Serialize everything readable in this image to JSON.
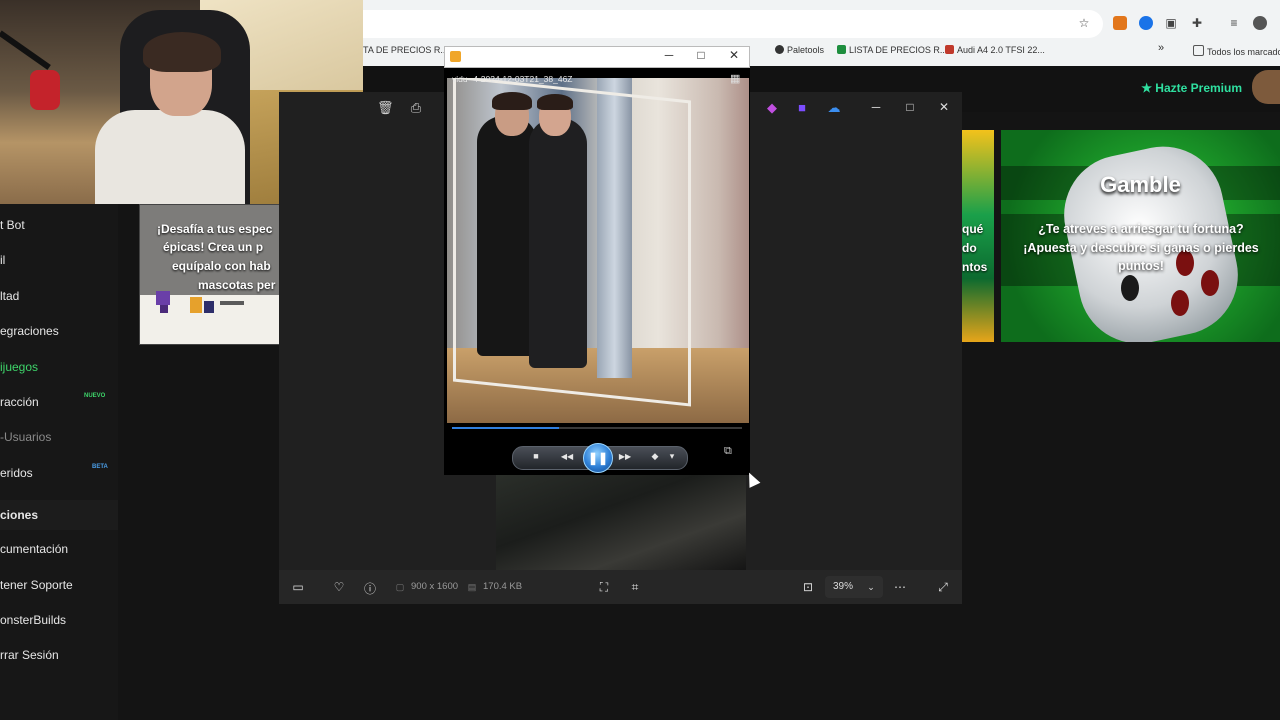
{
  "browser": {
    "bookmarks": [
      {
        "label": "TA DE PRECIOS R...",
        "icon": "none"
      },
      {
        "label": "Paletools",
        "icon": "circle-icon"
      },
      {
        "label": "LISTA DE PRECIOS R...",
        "icon": "sheets-icon"
      },
      {
        "label": "Audi A4 2.0 TFSI 22...",
        "icon": "site-icon"
      },
      {
        "label": "Todos los marcado",
        "icon": "folder-icon"
      }
    ],
    "more_bookmarks": "»"
  },
  "site": {
    "premium_label": "Hazte Premium",
    "premium_icon": "★"
  },
  "sidebar": {
    "items": [
      {
        "label": "t Bot"
      },
      {
        "label": "il"
      },
      {
        "label": "ltad"
      },
      {
        "label": "egraciones"
      },
      {
        "label": "ijuegos"
      },
      {
        "label": "racción",
        "badge": "NUEVO"
      },
      {
        "label": "-Usuarios"
      },
      {
        "label": "eridos",
        "badge": "BETA"
      },
      {
        "label": "ciones"
      },
      {
        "label": "cumentación"
      },
      {
        "label": "tener Soporte"
      },
      {
        "label": "onsterBuilds"
      },
      {
        "label": "rrar Sesión"
      }
    ]
  },
  "cards": {
    "challenge_text": "¡Desafía a tus espec épicas! Crea un p equípalo con hab mascotas per",
    "challenge_lines": [
      "¡Desafía a tus espec",
      "épicas! Crea un p",
      "equípalo con hab",
      "mascotas per"
    ],
    "mid_lines": [
      "qué",
      "do",
      "ntos"
    ],
    "gamble_title": "Gamble",
    "gamble_lines": [
      "¿Te atreves a arriesgar tu fortuna?",
      "¡Apuesta y descubre si ganas o pierdes",
      "puntos!"
    ]
  },
  "photos": {
    "dimensions": "900 x 1600",
    "file_size": "170.4 KB",
    "zoom": "39%"
  },
  "player": {
    "filename": "vidu--4-2024-12-03T21_38_46Z",
    "progress": 0.37,
    "controls": {
      "stop": "■",
      "rewind": "◀◀",
      "pause": "❚❚",
      "forward": "▶▶",
      "volume": "◆",
      "dropdown": "▾"
    }
  },
  "colors": {
    "accent_green": "#3ed46a",
    "premium_teal": "#2fe0a0",
    "player_blue": "#2f7fe0"
  }
}
